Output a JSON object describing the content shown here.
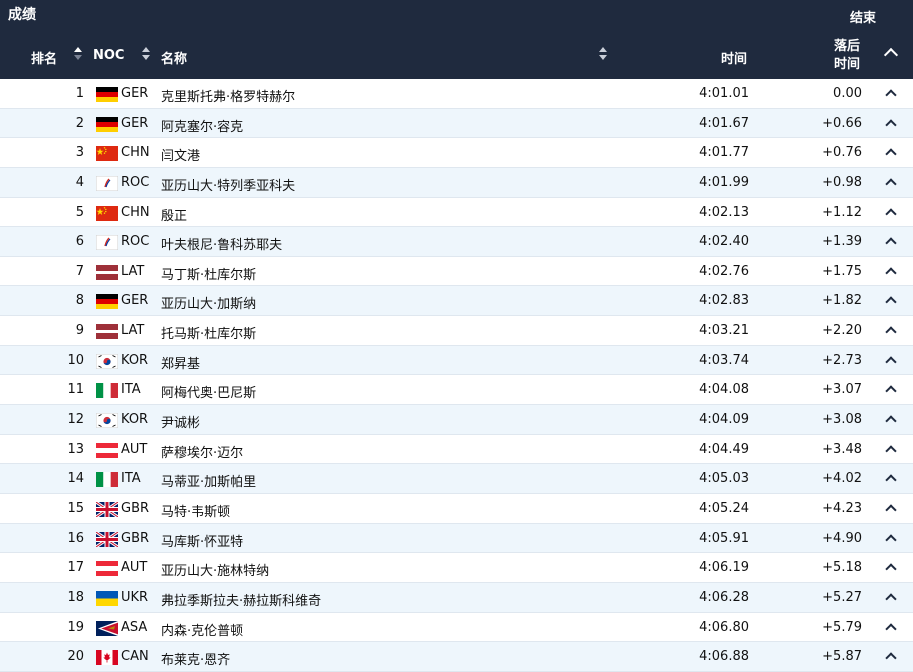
{
  "header": {
    "title": "成绩",
    "status": "结束",
    "columns": {
      "rank": "排名",
      "noc": "NOC",
      "name": "名称",
      "time": "时间",
      "behind_line1": "落后",
      "behind_line2": "时间"
    }
  },
  "rows": [
    {
      "rank": "1",
      "flag": "GER",
      "noc": "GER",
      "name": "克里斯托弗·格罗特赫尔",
      "time": "4:01.01",
      "behind": "0.00"
    },
    {
      "rank": "2",
      "flag": "GER",
      "noc": "GER",
      "name": "阿克塞尔·容克",
      "time": "4:01.67",
      "behind": "+0.66"
    },
    {
      "rank": "3",
      "flag": "CHN",
      "noc": "CHN",
      "name": "闫文港",
      "time": "4:01.77",
      "behind": "+0.76"
    },
    {
      "rank": "4",
      "flag": "ROC",
      "noc": "ROC",
      "name": "亚历山大·特列季亚科夫",
      "time": "4:01.99",
      "behind": "+0.98"
    },
    {
      "rank": "5",
      "flag": "CHN",
      "noc": "CHN",
      "name": "殷正",
      "time": "4:02.13",
      "behind": "+1.12"
    },
    {
      "rank": "6",
      "flag": "ROC",
      "noc": "ROC",
      "name": "叶夫根尼·鲁科苏耶夫",
      "time": "4:02.40",
      "behind": "+1.39"
    },
    {
      "rank": "7",
      "flag": "LAT",
      "noc": "LAT",
      "name": "马丁斯·杜库尔斯",
      "time": "4:02.76",
      "behind": "+1.75"
    },
    {
      "rank": "8",
      "flag": "GER",
      "noc": "GER",
      "name": "亚历山大·加斯纳",
      "time": "4:02.83",
      "behind": "+1.82"
    },
    {
      "rank": "9",
      "flag": "LAT",
      "noc": "LAT",
      "name": "托马斯·杜库尔斯",
      "time": "4:03.21",
      "behind": "+2.20"
    },
    {
      "rank": "10",
      "flag": "KOR",
      "noc": "KOR",
      "name": "郑昇基",
      "time": "4:03.74",
      "behind": "+2.73"
    },
    {
      "rank": "11",
      "flag": "ITA",
      "noc": "ITA",
      "name": "阿梅代奥·巴尼斯",
      "time": "4:04.08",
      "behind": "+3.07"
    },
    {
      "rank": "12",
      "flag": "KOR",
      "noc": "KOR",
      "name": "尹诚彬",
      "time": "4:04.09",
      "behind": "+3.08"
    },
    {
      "rank": "13",
      "flag": "AUT",
      "noc": "AUT",
      "name": "萨穆埃尔·迈尔",
      "time": "4:04.49",
      "behind": "+3.48"
    },
    {
      "rank": "14",
      "flag": "ITA",
      "noc": "ITA",
      "name": "马蒂亚·加斯帕里",
      "time": "4:05.03",
      "behind": "+4.02"
    },
    {
      "rank": "15",
      "flag": "GBR",
      "noc": "GBR",
      "name": "马特·韦斯顿",
      "time": "4:05.24",
      "behind": "+4.23"
    },
    {
      "rank": "16",
      "flag": "GBR",
      "noc": "GBR",
      "name": "马库斯·怀亚特",
      "time": "4:05.91",
      "behind": "+4.90"
    },
    {
      "rank": "17",
      "flag": "AUT",
      "noc": "AUT",
      "name": "亚历山大·施林特纳",
      "time": "4:06.19",
      "behind": "+5.18"
    },
    {
      "rank": "18",
      "flag": "UKR",
      "noc": "UKR",
      "name": "弗拉季斯拉夫·赫拉斯科维奇",
      "time": "4:06.28",
      "behind": "+5.27"
    },
    {
      "rank": "19",
      "flag": "ASA",
      "noc": "ASA",
      "name": "内森·克伦普顿",
      "time": "4:06.80",
      "behind": "+5.79"
    },
    {
      "rank": "20",
      "flag": "CAN",
      "noc": "CAN",
      "name": "布莱克·恩齐",
      "time": "4:06.88",
      "behind": "+5.87"
    }
  ],
  "colors": {
    "header_bg": "#1f2a3e",
    "row_alt_bg": "#eef6fc",
    "row_border": "#dfe7ef"
  }
}
